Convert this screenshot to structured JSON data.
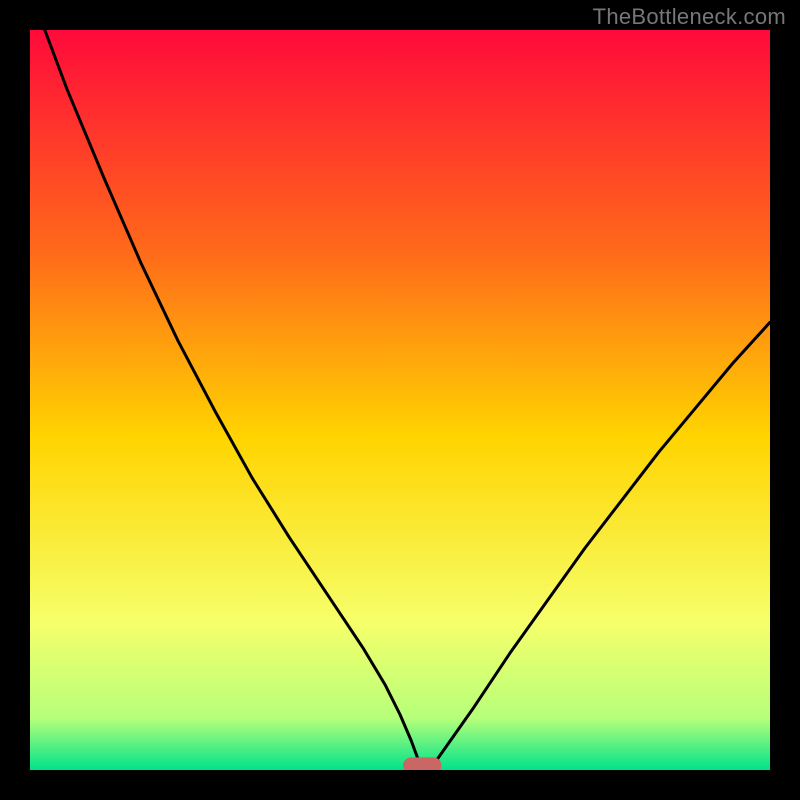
{
  "watermark": "TheBottleneck.com",
  "colors": {
    "frame": "#000000",
    "curve": "#000000",
    "marker_fill": "#c96764",
    "grad_top": "#ff0a3a",
    "grad_mid_upper": "#ff6a1a",
    "grad_mid": "#ffd400",
    "grad_mid_lower": "#f6ff6a",
    "grad_near_bottom": "#b6ff7a",
    "grad_bottom": "#00e38a"
  },
  "chart_data": {
    "type": "line",
    "title": "",
    "xlabel": "",
    "ylabel": "",
    "xlim": [
      0,
      100
    ],
    "ylim": [
      0,
      100
    ],
    "grid": false,
    "legend": false,
    "annotations": [],
    "series": [
      {
        "name": "bottleneck-curve",
        "x": [
          2,
          5,
          10,
          15,
          20,
          25,
          30,
          35,
          40,
          45,
          48,
          50,
          51.5,
          52.5,
          53.5,
          55,
          60,
          65,
          70,
          75,
          80,
          85,
          90,
          95,
          100
        ],
        "values": [
          100,
          92,
          80,
          68.5,
          58,
          48.5,
          39.5,
          31.5,
          24,
          16.5,
          11.5,
          7.5,
          4,
          1.3,
          0.5,
          1.4,
          8.5,
          16,
          23,
          30,
          36.5,
          43,
          49,
          55,
          60.5
        ]
      }
    ],
    "marker": {
      "name": "optimal-point",
      "x": 53,
      "y": 0.6,
      "rx": 2.6,
      "ry": 1.1
    },
    "gradient_stops": [
      {
        "offset": 0.0,
        "color": "#ff0a3a"
      },
      {
        "offset": 0.3,
        "color": "#ff6a1a"
      },
      {
        "offset": 0.55,
        "color": "#ffd400"
      },
      {
        "offset": 0.8,
        "color": "#f6ff6a"
      },
      {
        "offset": 0.93,
        "color": "#b6ff7a"
      },
      {
        "offset": 1.0,
        "color": "#00e38a"
      }
    ]
  }
}
